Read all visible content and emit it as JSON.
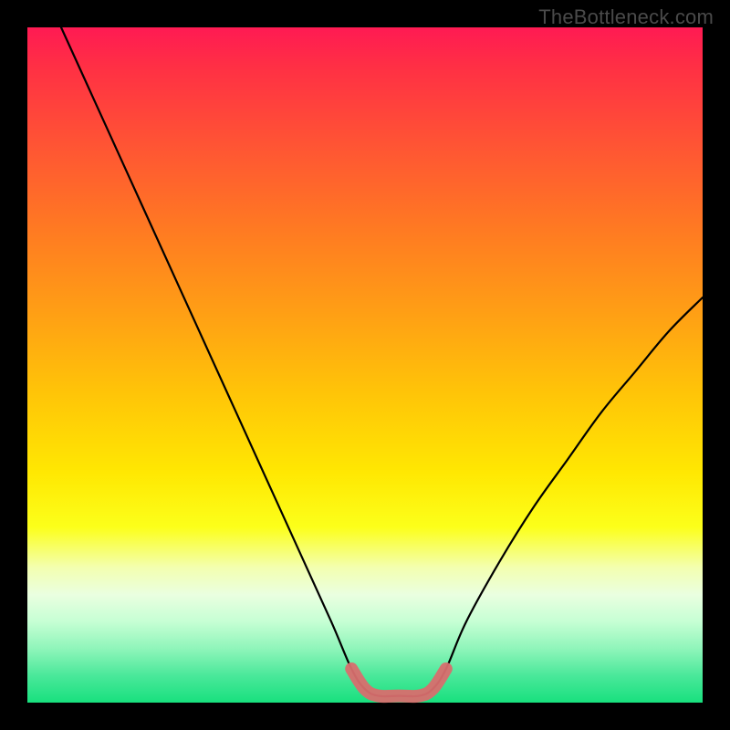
{
  "watermark": "TheBottleneck.com",
  "chart_data": {
    "type": "line",
    "title": "",
    "xlabel": "",
    "ylabel": "",
    "xlim": [
      0,
      100
    ],
    "ylim": [
      0,
      100
    ],
    "series": [
      {
        "name": "bottleneck-main-curve",
        "color": "#000000",
        "x": [
          5,
          10,
          15,
          20,
          25,
          30,
          35,
          40,
          45,
          48,
          50,
          52,
          55,
          58,
          60,
          62,
          65,
          70,
          75,
          80,
          85,
          90,
          95,
          100
        ],
        "values": [
          100,
          89,
          78,
          67,
          56,
          45,
          34,
          23,
          12,
          5,
          2,
          1,
          1,
          1,
          2,
          5,
          12,
          21,
          29,
          36,
          43,
          49,
          55,
          60
        ]
      },
      {
        "name": "bottleneck-highlight-range",
        "color": "#d86e6e",
        "x": [
          48,
          50,
          52,
          55,
          58,
          60,
          62
        ],
        "values": [
          5,
          2,
          1,
          1,
          1,
          2,
          5
        ]
      }
    ]
  }
}
